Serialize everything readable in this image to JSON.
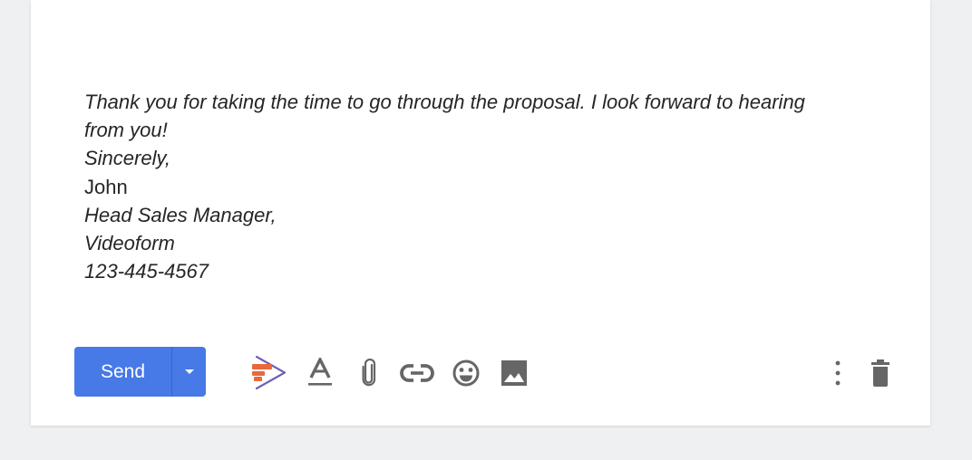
{
  "email": {
    "body_lines": [
      "Thank you for taking the time to go through the proposal. I look forward to hearing from you!",
      "Sincerely,",
      "John",
      "Head Sales Manager,",
      "Videoform",
      "123-445-4567"
    ]
  },
  "toolbar": {
    "send_label": "Send",
    "more_send_options_icon": "caret-down-icon",
    "tools": [
      {
        "name": "videoform-extension-icon"
      },
      {
        "name": "text-format-icon"
      },
      {
        "name": "attach-file-icon"
      },
      {
        "name": "insert-link-icon"
      },
      {
        "name": "emoji-icon"
      },
      {
        "name": "insert-photo-icon"
      },
      {
        "name": "more-options-icon"
      },
      {
        "name": "discard-draft-icon"
      }
    ]
  },
  "colors": {
    "send_button": "#4779e7",
    "icon_gray": "#666666",
    "videoform_orange": "#e8693c",
    "videoform_purple": "#6f62b5"
  }
}
